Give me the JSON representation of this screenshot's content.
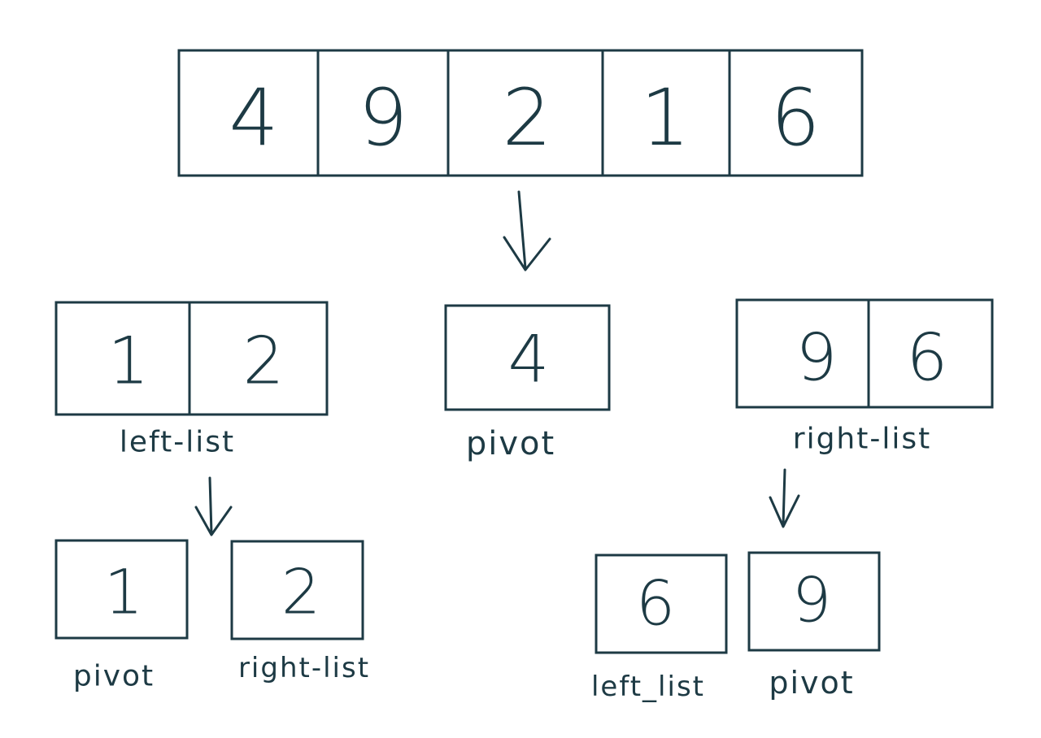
{
  "colors": {
    "ink": "#1d3a44",
    "background": "#ffffff"
  },
  "input_array": {
    "values": [
      "4",
      "9",
      "2",
      "1",
      "6"
    ]
  },
  "level1": {
    "left": {
      "values": [
        "1",
        "2"
      ],
      "caption": "left-list"
    },
    "pivot": {
      "values": [
        "4"
      ],
      "caption": "pivot"
    },
    "right": {
      "values": [
        "9",
        "6"
      ],
      "caption": "right-list"
    }
  },
  "level2_left": {
    "pivot": {
      "value": "1",
      "caption": "pivot"
    },
    "right": {
      "value": "2",
      "caption": "right-list"
    }
  },
  "level2_right": {
    "left": {
      "value": "6",
      "caption": "left_list"
    },
    "pivot": {
      "value": "9",
      "caption": "pivot"
    }
  },
  "icons": [
    "down-arrow-icon"
  ]
}
